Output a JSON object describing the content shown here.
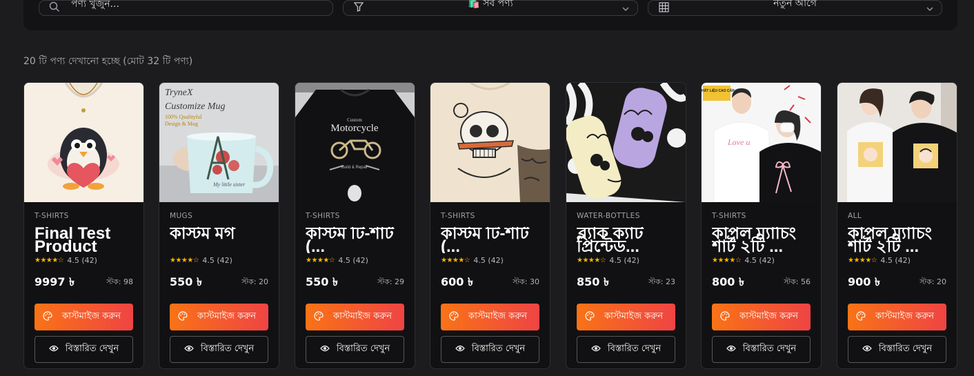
{
  "filters": {
    "search_placeholder": "পণ্য খুঁজুন...",
    "category_value": "🛍️ সব পণ্য",
    "sort_value": "নতুন আগে"
  },
  "summary": "20 টি পণ্য দেখানো হচ্ছে (মোট 32 টি পণ্য)",
  "labels": {
    "customize": "কাস্টমাইজ করুন",
    "details": "বিস্তারিত দেখুন"
  },
  "products": [
    {
      "category": "T-SHIRTS",
      "title": "Final Test Product",
      "rating": "4.5 (42)",
      "price": "9997 ৳",
      "stock": "স্টক: 98",
      "image": "penguin-tshirt"
    },
    {
      "category": "MUGS",
      "title": "কাস্টম মগ",
      "rating": "4.5 (42)",
      "price": "550 ৳",
      "stock": "স্টক: 20",
      "image": "custom-mug",
      "image_text": [
        "TryneX",
        "Customize Mug",
        "100% Qualityful",
        "Design & Mug",
        "My little sister"
      ]
    },
    {
      "category": "T-SHIRTS",
      "title": "কাস্টম টি-শার্ট (...",
      "rating": "4.5 (42)",
      "price": "550 ৳",
      "stock": "স্টক: 29",
      "image": "motorcycle-tshirt",
      "image_text": [
        "Custom",
        "Motorcycle",
        "Build & Repair"
      ]
    },
    {
      "category": "T-SHIRTS",
      "title": "কাস্টম টি-শার্ট (...",
      "rating": "4.5 (42)",
      "price": "600 ৳",
      "stock": "স্টক: 30",
      "image": "skull-tshirt"
    },
    {
      "category": "WATER-BOTTLES",
      "title": "ব্ল্যাক ক্যাট প্রিন্টেড...",
      "rating": "4.5 (42)",
      "price": "850 ৳",
      "stock": "স্টক: 23",
      "image": "cat-bottles"
    },
    {
      "category": "T-SHIRTS",
      "title": "কাপল ম্যাচিং শার্ট ২টি ...",
      "rating": "4.5 (42)",
      "price": "800 ৳",
      "stock": "স্টক: 56",
      "image": "couple-love-tshirt",
      "image_text": [
        "CHẤT LIỆU CAO CẤP",
        "Love u"
      ]
    },
    {
      "category": "ALL",
      "title": "কাপল ম্যাচিং শার্ট ২টি ...",
      "rating": "4.5 (42)",
      "price": "900 ৳",
      "stock": "স্টক: 20",
      "image": "couple-cartoon-tshirt"
    }
  ],
  "colors": {
    "accent_start": "#f97316",
    "accent_end": "#ef4444",
    "star": "#f5b400",
    "background": "#1c1c1f",
    "card": "#111113"
  }
}
